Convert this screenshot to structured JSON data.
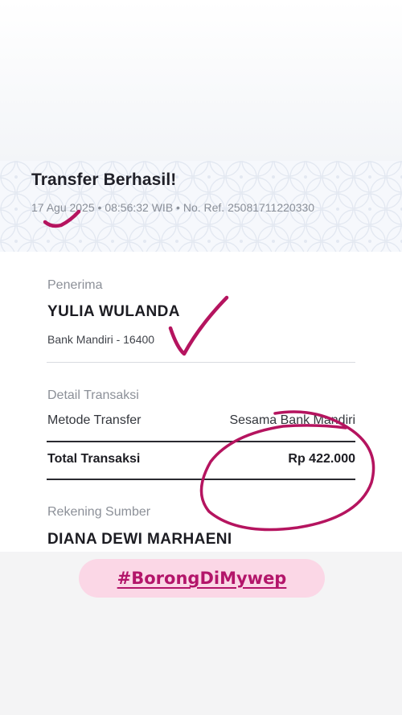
{
  "header": {
    "title": "Transfer Berhasil!",
    "date": "17 Agu 2025",
    "time": "08:56:32 WIB",
    "ref": "No. Ref. 25081711220330",
    "separator": "•"
  },
  "recipient": {
    "section_label": "Penerima",
    "name": "YULIA WULANDA",
    "bank_account": "Bank Mandiri - 16400"
  },
  "transaction": {
    "section_label": "Detail Transaksi",
    "method_label": "Metode Transfer",
    "method_value": "Sesama Bank Mandiri",
    "total_label": "Total Transaksi",
    "total_value": "Rp 422.000"
  },
  "source": {
    "section_label": "Rekening Sumber",
    "name": "DIANA DEWI MARHAENI"
  },
  "sticker": {
    "hashtag": "#BorongDiMywep"
  },
  "colors": {
    "annotation": "#b5145f",
    "hashtag_bg": "#fbd7e6",
    "hashtag_text": "#b3156a"
  }
}
